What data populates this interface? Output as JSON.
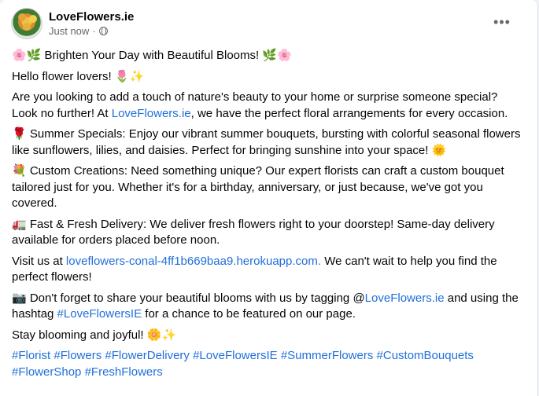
{
  "post": {
    "author": "LoveFlowers.ie",
    "timestamp": "Just now",
    "separator": "·",
    "more_icon": "•••",
    "headline": "🌸🌿 Brighten Your Day with Beautiful Blooms! 🌿🌸",
    "greeting": "Hello flower lovers! 🌷✨",
    "intro_a": "Are you looking to add a touch of nature's beauty to your home or surprise someone special? Look no further! At ",
    "intro_link": "LoveFlowers.ie",
    "intro_b": ", we have the perfect floral arrangements for every occasion.",
    "summer": "🌹 Summer Specials: Enjoy our vibrant summer bouquets, bursting with colorful seasonal flowers like sunflowers, lilies, and daisies. Perfect for bringing sunshine into your space! 🌞",
    "custom": "💐 Custom Creations: Need something unique? Our expert florists can craft a custom bouquet tailored just for you. Whether it's for a birthday, anniversary, or just because, we've got you covered.",
    "delivery": "🚛 Fast & Fresh Delivery: We deliver fresh flowers right to your doorstep! Same-day delivery available for orders placed before noon.",
    "visit_a": "Visit us at ",
    "visit_link": "loveflowers-conal-4ff1b669baa9.herokuapp.com.",
    "visit_b": " We can't wait to help you find the perfect flowers!",
    "share_a": "📷 Don't forget to share your beautiful blooms with us by tagging @",
    "share_link": "LoveFlowers.ie",
    "share_b": " and using the hashtag ",
    "share_tag": "#LoveFlowersIE",
    "share_c": " for a chance to be featured on our page.",
    "closing": "Stay blooming and joyful! 🌼✨",
    "hashtags": [
      "#Florist",
      "#Flowers",
      "#FlowerDelivery",
      "#LoveFlowersIE",
      "#SummerFlowers",
      "#CustomBouquets",
      "#FlowerShop",
      "#FreshFlowers"
    ]
  },
  "colors": {
    "link": "#216fdb",
    "secondary_text": "#65676b",
    "primary_text": "#050505"
  }
}
